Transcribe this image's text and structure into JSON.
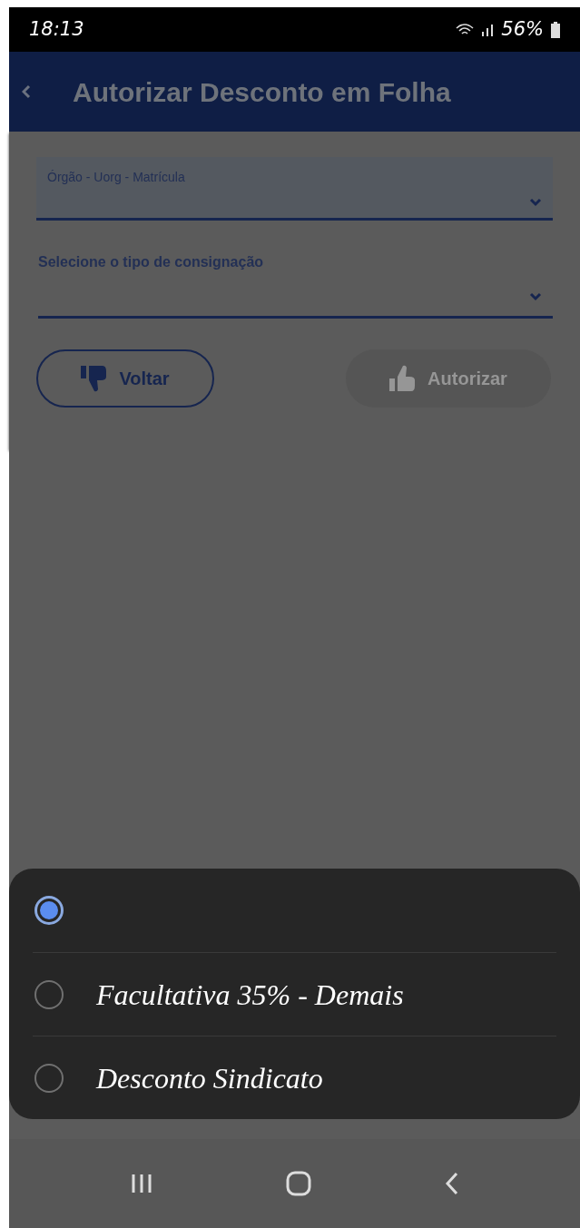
{
  "status_bar": {
    "time": "18:13",
    "battery": "56%"
  },
  "header": {
    "title": "Autorizar Desconto em Folha"
  },
  "form": {
    "field_label": "Órgão - Uorg - Matrícula",
    "select_label": "Selecione o tipo de consignação"
  },
  "buttons": [
    {
      "label": "Voltar",
      "disabled": false
    },
    {
      "label": "Autorizar",
      "disabled": true
    }
  ],
  "options": [
    {
      "selected": true
    },
    {
      "label": "Facultativa 35% - Demais",
      "selected": false
    },
    {
      "label": "Desconto Sindicato",
      "selected": false
    }
  ]
}
